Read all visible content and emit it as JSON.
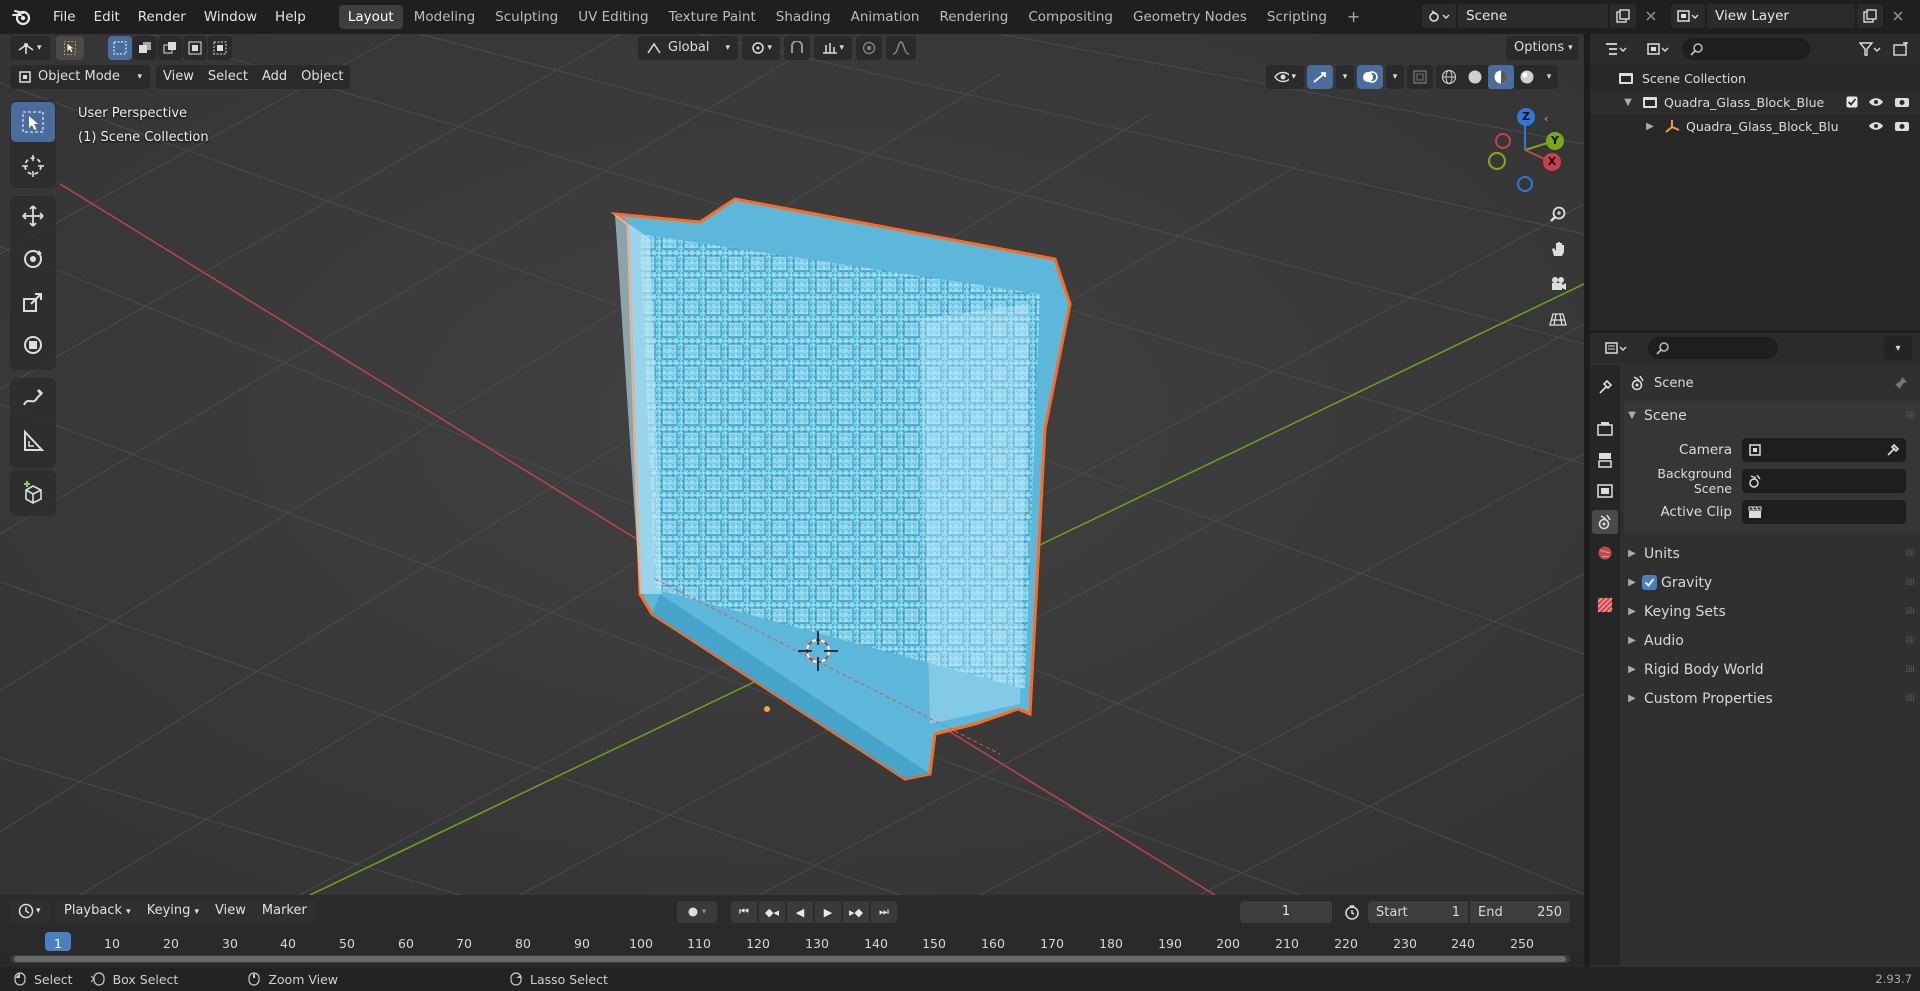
{
  "topbar": {
    "menus": [
      "File",
      "Edit",
      "Render",
      "Window",
      "Help"
    ],
    "workspaces": [
      "Layout",
      "Modeling",
      "Sculpting",
      "UV Editing",
      "Texture Paint",
      "Shading",
      "Animation",
      "Rendering",
      "Compositing",
      "Geometry Nodes",
      "Scripting"
    ],
    "active_workspace": "Layout",
    "add_tab": "+",
    "scene": "Scene",
    "view_layer": "View Layer"
  },
  "viewport": {
    "mode": "Object Mode",
    "menus": [
      "View",
      "Select",
      "Add",
      "Object"
    ],
    "orientation": "Global",
    "options": "Options",
    "overlay_title": "User Perspective",
    "overlay_collection": "(1) Scene Collection",
    "gizmo_axes": {
      "x": "X",
      "y": "Y",
      "z": "Z"
    },
    "colors": {
      "x_axis": "#c9404a",
      "y_axis": "#7aa51e",
      "z_axis": "#2f78d8",
      "selection_outline": "#ff6a1f",
      "glass": "#6cc7e8"
    }
  },
  "outliner": {
    "root": "Scene Collection",
    "collection": "Quadra_Glass_Block_Blue",
    "object": "Quadra_Glass_Block_Blu"
  },
  "properties": {
    "context": "Scene",
    "section": "Scene",
    "fields": {
      "camera_label": "Camera",
      "background_label": "Background Scene",
      "clip_label": "Active Clip"
    },
    "subsections": [
      "Units",
      "Gravity",
      "Keying Sets",
      "Audio",
      "Rigid Body World",
      "Custom Properties"
    ],
    "gravity_checked": true
  },
  "timeline": {
    "menus": [
      "Playback",
      "Keying",
      "View",
      "Marker"
    ],
    "current_frame": "1",
    "start_label": "Start",
    "start": "1",
    "end_label": "End",
    "end": "250",
    "ruler": [
      "1",
      "10",
      "20",
      "30",
      "40",
      "50",
      "60",
      "70",
      "80",
      "90",
      "100",
      "110",
      "120",
      "130",
      "140",
      "150",
      "160",
      "170",
      "180",
      "190",
      "200",
      "210",
      "220",
      "230",
      "240",
      "250"
    ]
  },
  "statusbar": {
    "select": "Select",
    "box_select": "Box Select",
    "zoom": "Zoom View",
    "lasso": "Lasso Select",
    "version": "2.93.7"
  }
}
